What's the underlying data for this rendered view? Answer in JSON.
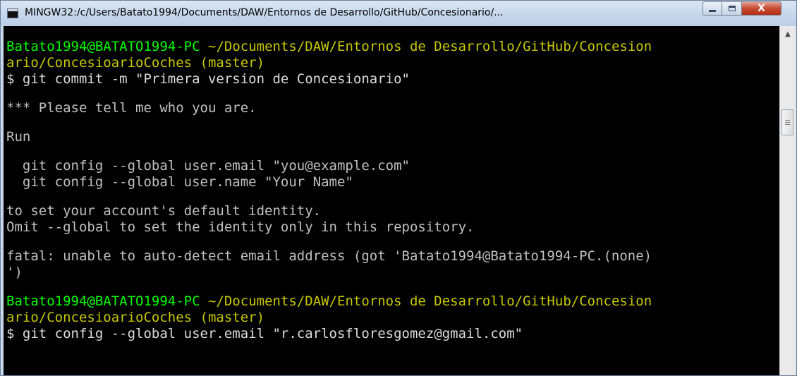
{
  "window": {
    "title": "MINGW32:/c/Users/Batato1994/Documents/DAW/Entornos de Desarrollo/GitHub/Concesionario/...",
    "app_icon": "console-icon",
    "buttons": {
      "minimize_icon": "minimize-icon",
      "maximize_icon": "maximize-icon",
      "close_label": "X"
    }
  },
  "console": {
    "background": "#000000",
    "colors": {
      "prompt_user": "#00ff00",
      "prompt_path": "#c8c800",
      "output": "#c0c0c0"
    },
    "prompt1": {
      "user": "Batato1994@BATATO1994-PC",
      "path_line1": "~/Documents/DAW/Entornos de Desarrollo/GitHub/Concesion",
      "path_line2": "ario/ConcesioarioCoches (master)",
      "command": "$ git commit -m \"Primera version de Concesionario\""
    },
    "output": {
      "line1": "*** Please tell me who you are.",
      "line2": "Run",
      "line3": "  git config --global user.email \"you@example.com\"",
      "line4": "  git config --global user.name \"Your Name\"",
      "line5": "to set your account's default identity.",
      "line6": "Omit --global to set the identity only in this repository.",
      "line7": "fatal: unable to auto-detect email address (got 'Batato1994@Batato1994-PC.(none)",
      "line8": "')"
    },
    "prompt2": {
      "user": "Batato1994@BATATO1994-PC",
      "path_line1": "~/Documents/DAW/Entornos de Desarrollo/GitHub/Concesion",
      "path_line2": "ario/ConcesioarioCoches (master)",
      "command": "$ git config --global user.email \"r.carlosfloresgomez@gmail.com\""
    }
  },
  "scrollbar": {
    "up_arrow_icon": "scroll-up-arrow-icon"
  }
}
